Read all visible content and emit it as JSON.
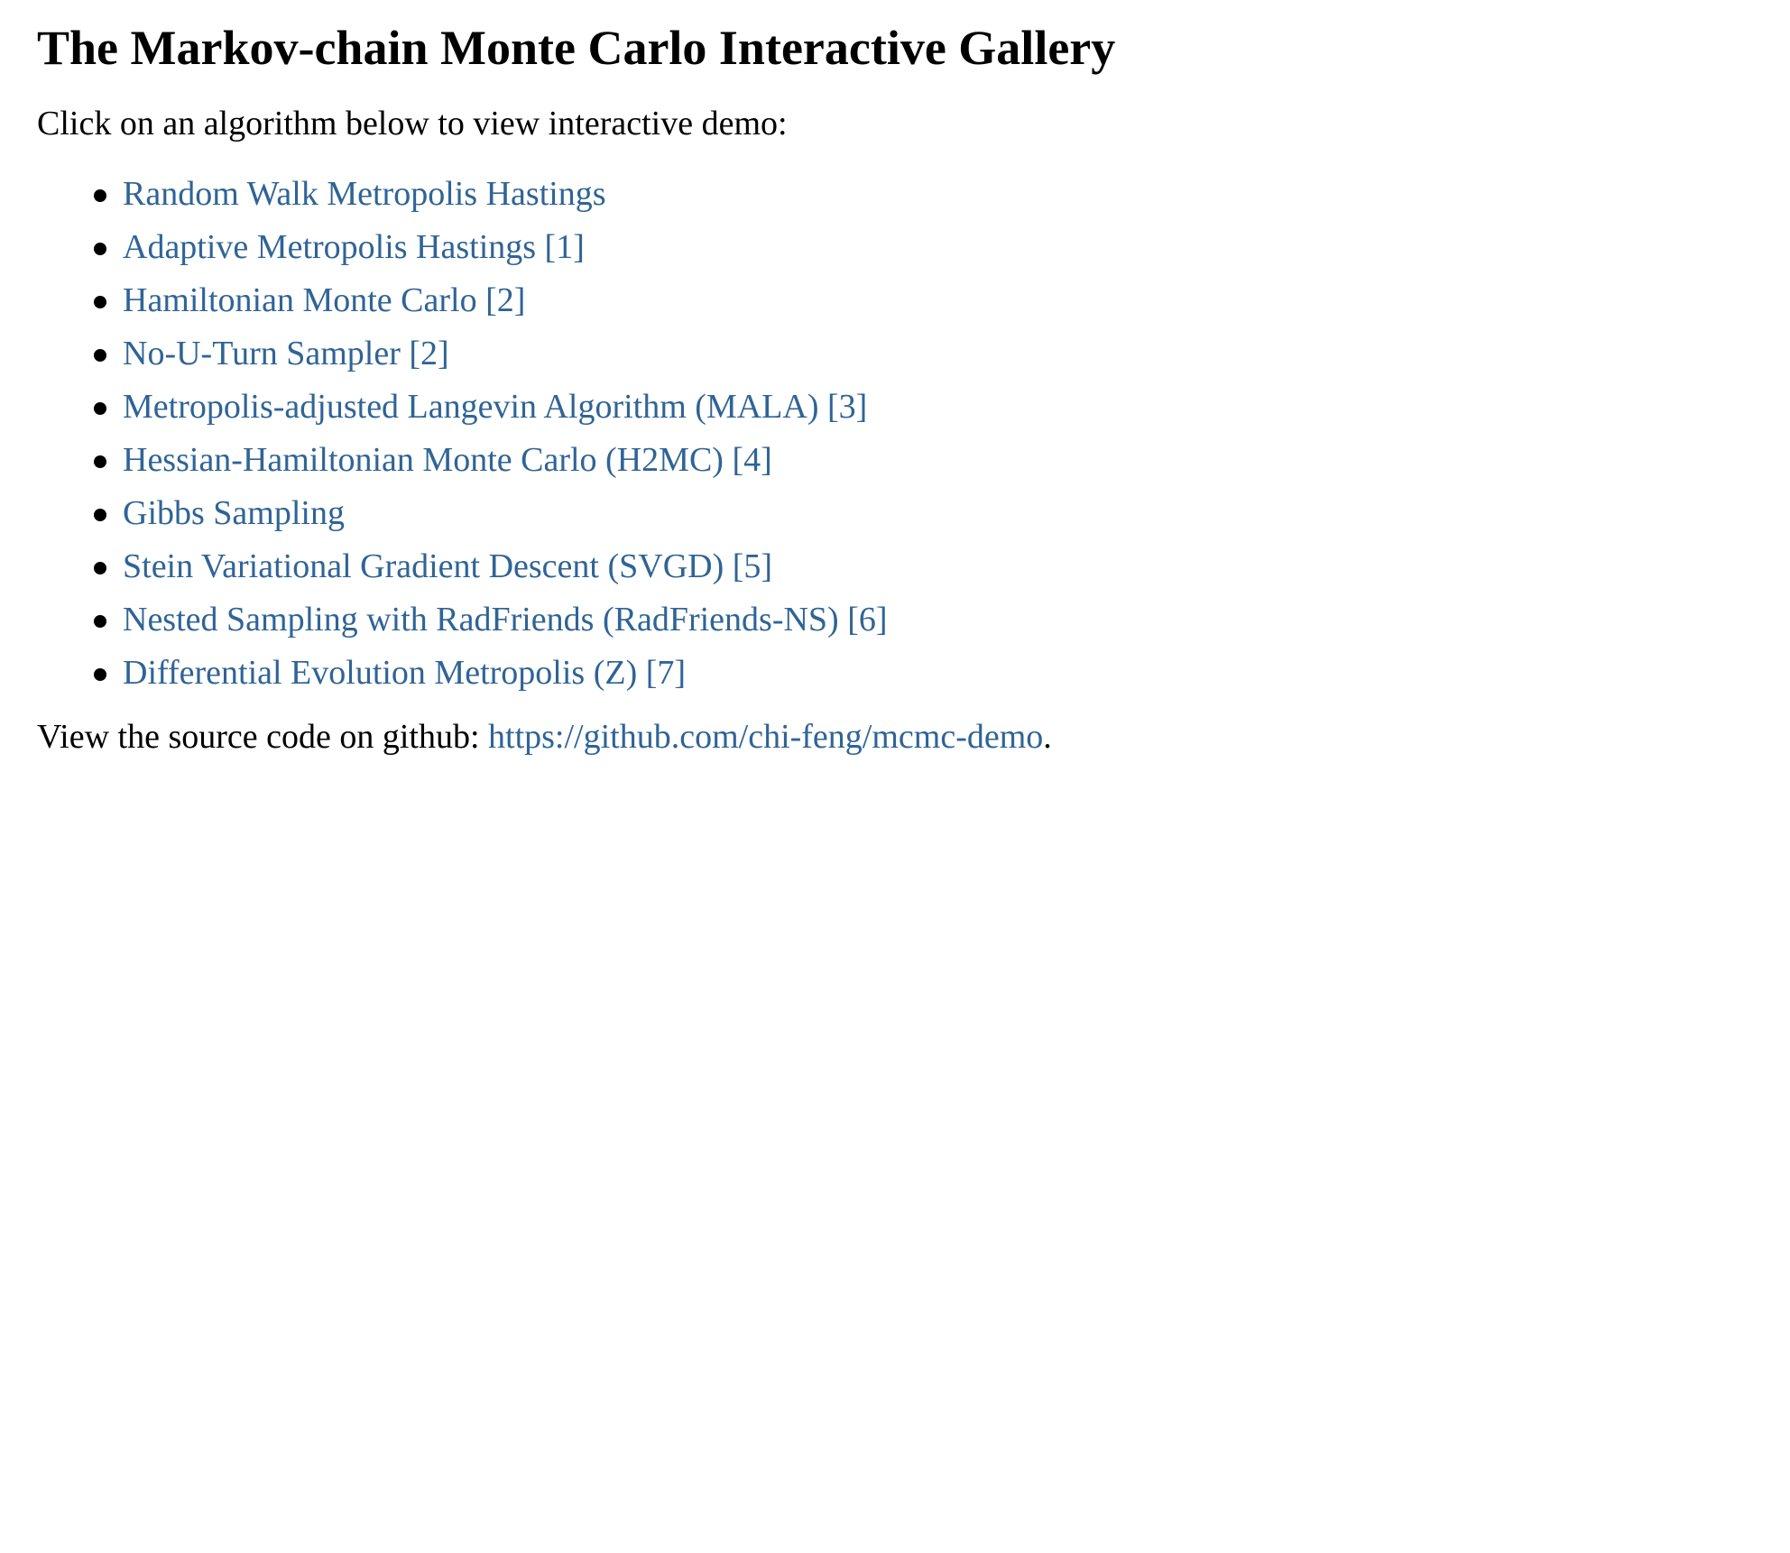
{
  "page": {
    "title": "The Markov-chain Monte Carlo Interactive Gallery",
    "intro": "Click on an algorithm below to view interactive demo:",
    "algorithms": [
      "Random Walk Metropolis Hastings",
      "Adaptive Metropolis Hastings [1]",
      "Hamiltonian Monte Carlo [2]",
      "No-U-Turn Sampler [2]",
      "Metropolis-adjusted Langevin Algorithm (MALA) [3]",
      "Hessian-Hamiltonian Monte Carlo (H2MC) [4]",
      "Gibbs Sampling",
      "Stein Variational Gradient Descent (SVGD) [5]",
      "Nested Sampling with RadFriends (RadFriends-NS) [6]",
      "Differential Evolution Metropolis (Z) [7]"
    ],
    "source_prefix": "View the source code on github: ",
    "source_link": "https://github.com/chi-feng/mcmc-demo",
    "source_suffix": "."
  },
  "colors": {
    "link": "#2f6496",
    "text": "#000000",
    "background": "#ffffff"
  }
}
